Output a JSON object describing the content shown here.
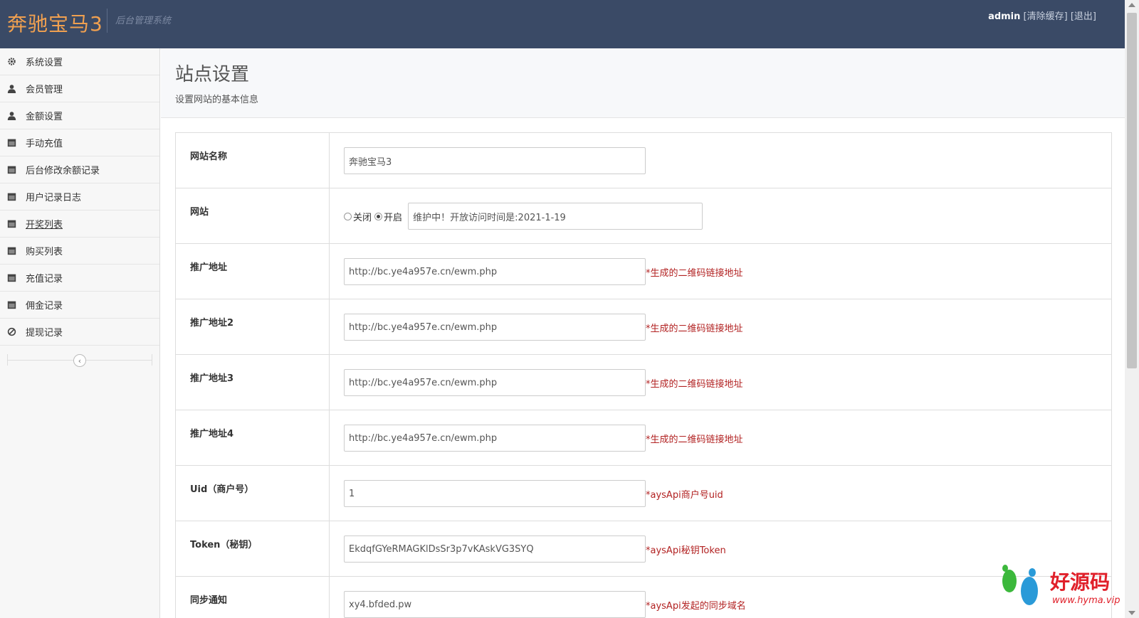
{
  "header": {
    "brand": "奔驰宝马3",
    "subtitle": "后台管理系统",
    "user": "admin",
    "clear_cache": "[清除缓存]",
    "logout": "[退出]"
  },
  "sidebar": {
    "items": [
      {
        "label": "系统设置",
        "icon": "gear-icon"
      },
      {
        "label": "会员管理",
        "icon": "user-icon"
      },
      {
        "label": "金额设置",
        "icon": "user-icon"
      },
      {
        "label": "手动充值",
        "icon": "calendar-icon"
      },
      {
        "label": "后台修改余额记录",
        "icon": "calendar-icon"
      },
      {
        "label": "用户记录日志",
        "icon": "calendar-icon"
      },
      {
        "label": "开奖列表",
        "icon": "calendar-icon"
      },
      {
        "label": "购买列表",
        "icon": "calendar-icon"
      },
      {
        "label": "充值记录",
        "icon": "calendar-icon"
      },
      {
        "label": "佣金记录",
        "icon": "calendar-icon"
      },
      {
        "label": "提现记录",
        "icon": "ban-icon"
      }
    ],
    "collapse_glyph": "‹"
  },
  "page": {
    "title": "站点设置",
    "subtitle": "设置网站的基本信息"
  },
  "form": {
    "site_name": {
      "label": "网站名称",
      "value": "奔驰宝马3"
    },
    "site_status": {
      "label": "网站",
      "options": [
        "关闭",
        "开启"
      ],
      "selected": "开启",
      "message": "维护中！开放访问时间是:2021-1-19"
    },
    "promo1": {
      "label": "推广地址",
      "value": "http://bc.ye4a957e.cn/ewm.php",
      "hint": "*生成的二维码链接地址"
    },
    "promo2": {
      "label": "推广地址2",
      "value": "http://bc.ye4a957e.cn/ewm.php",
      "hint": "*生成的二维码链接地址"
    },
    "promo3": {
      "label": "推广地址3",
      "value": "http://bc.ye4a957e.cn/ewm.php",
      "hint": "*生成的二维码链接地址"
    },
    "promo4": {
      "label": "推广地址4",
      "value": "http://bc.ye4a957e.cn/ewm.php",
      "hint": "*生成的二维码链接地址"
    },
    "uid": {
      "label": "Uid（商户号）",
      "value": "1",
      "hint": "*aysApi商户号uid"
    },
    "token": {
      "label": "Token（秘钥）",
      "value": "EkdqfGYeRMAGKlDsSr3p7vKAskVG3SYQ",
      "hint": "*aysApi秘钥Token"
    },
    "sync": {
      "label": "同步通知",
      "value": "xy4.bfded.pw",
      "hint": "*aysApi发起的同步域名"
    }
  },
  "watermark": {
    "text": "好源码",
    "url": "www.hyma.vip"
  },
  "colors": {
    "header_bg": "#3a4a66",
    "brand": "#f0a050",
    "hint": "#b22222"
  }
}
